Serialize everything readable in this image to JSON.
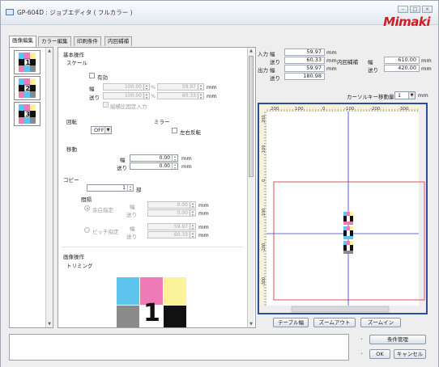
{
  "window": {
    "title": "GP-604D : ジョブエディタ ( フルカラー )",
    "logo": "Mimaki"
  },
  "tabs": [
    {
      "label": "画像編集",
      "active": true
    },
    {
      "label": "カラー編集",
      "active": false
    },
    {
      "label": "印刷条件",
      "active": false
    },
    {
      "label": "内回補補",
      "active": false
    }
  ],
  "thumbnails": [
    {
      "number": "1"
    },
    {
      "number": "2"
    },
    {
      "number": "3"
    }
  ],
  "editor": {
    "basic_ops": "基本操作",
    "scale": {
      "title": "スケール",
      "enable_label": "有効",
      "width_label": "幅",
      "height_label": "送り",
      "width_pct": "100.00",
      "height_pct": "100.00",
      "width_mm": "59.97",
      "height_mm": "60.33",
      "pct_unit": "%",
      "mm_unit": "mm",
      "ratio_label": "縦横比固定入力"
    },
    "rotation": {
      "title": "回転",
      "value": "OFF"
    },
    "mirror": {
      "title": "ミラー",
      "lr_label": "左右反転"
    },
    "move": {
      "title": "移動",
      "width_label": "幅",
      "feed_label": "送り",
      "width": "0.00",
      "feed": "0.00",
      "unit": "mm"
    },
    "copy": {
      "title": "コピー",
      "count": "1",
      "count_unit": "部",
      "spacing_title": "間隔",
      "margin_label": "余白指定",
      "pitch_label": "ピッチ指定",
      "width_label": "幅",
      "feed_label": "送り",
      "margin_w": "0.00",
      "margin_f": "0.00",
      "pitch_w": "59.97",
      "pitch_f": "60.33",
      "unit": "mm"
    },
    "image_ops": {
      "title": "画像操作",
      "trim": "トリミング",
      "preview_number": "1"
    }
  },
  "info": {
    "input_label": "入力",
    "output_label": "出力",
    "width_label": "幅",
    "feed_label": "送り",
    "input_w": "59.97",
    "input_f": "60.33",
    "output_w": "59.97",
    "output_f": "180.98",
    "unit": "mm",
    "inner_label": "内回補補",
    "inner_w_label": "幅",
    "inner_f_label": "送り",
    "inner_w": "610.00",
    "inner_f": "420.00",
    "cursor_label": "カーソルキー移動量",
    "cursor_value": "1",
    "cursor_unit": "mm"
  },
  "ruler": {
    "h_ticks": [
      "200",
      "100",
      "0",
      "-100",
      "-200",
      "-300"
    ],
    "v_ticks": [
      "200",
      "100",
      "0",
      "-100",
      "-200",
      "-300"
    ]
  },
  "canvas_buttons": {
    "table_width": "テーブル幅",
    "zoom_out": "ズームアウト",
    "zoom_in": "ズームイン"
  },
  "bottom": {
    "condition": "条件管理",
    "ok": "OK",
    "cancel": "キャンセル"
  },
  "colors": {
    "cyan": "#5ec6ee",
    "magenta": "#ee7ab8",
    "yellow": "#faf39a",
    "black": "#111111",
    "gray": "#8a8a8a",
    "canvas_border": "#2d4f9a",
    "logo_red": "#d01c23"
  }
}
